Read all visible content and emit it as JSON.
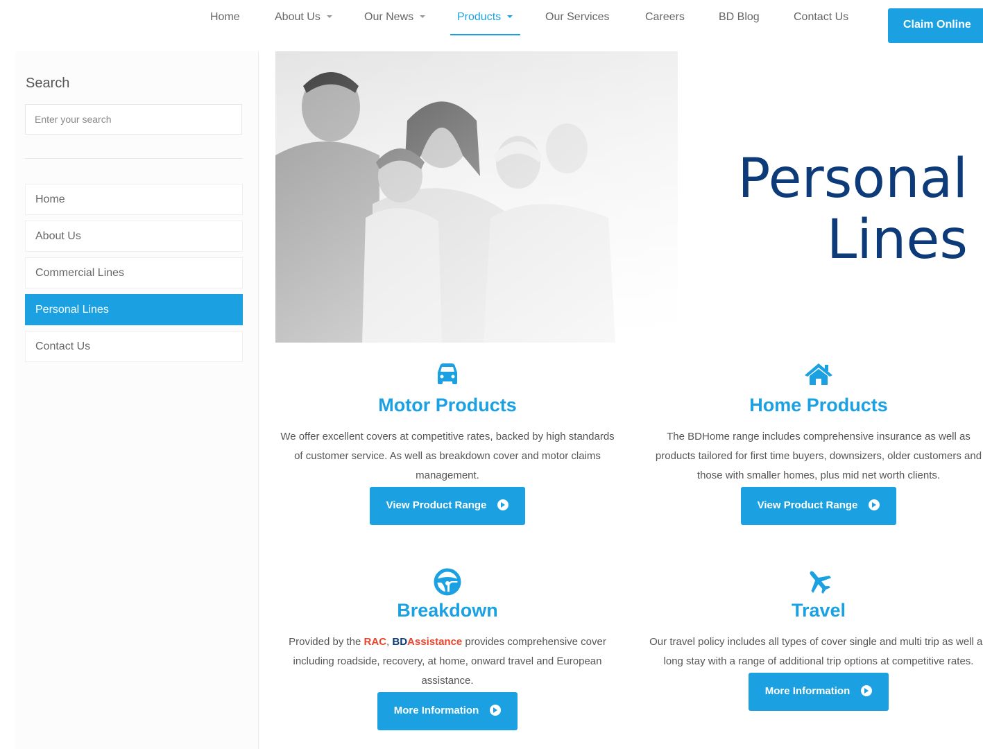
{
  "nav": {
    "items": [
      {
        "label": "Home"
      },
      {
        "label": "About Us"
      },
      {
        "label": "Our News"
      },
      {
        "label": "Products"
      },
      {
        "label": "Our Services"
      },
      {
        "label": "Careers"
      },
      {
        "label": "BD Blog"
      },
      {
        "label": "Contact Us"
      }
    ],
    "active": "Products",
    "claim_button": "Claim Online"
  },
  "sidebar": {
    "search_title": "Search",
    "search_placeholder": "Enter your search",
    "menu": [
      {
        "label": "Home"
      },
      {
        "label": "About Us"
      },
      {
        "label": "Commercial Lines"
      },
      {
        "label": "Personal Lines"
      },
      {
        "label": "Contact Us"
      }
    ],
    "active": "Personal Lines"
  },
  "hero": {
    "title_line1": "Personal",
    "title_line2": "Lines"
  },
  "products": [
    {
      "icon": "car-icon",
      "title": "Motor Products",
      "description": "We offer excellent covers at competitive rates, backed by high standards of customer service. As well as breakdown cover and motor claims management.",
      "button": "View Product Range"
    },
    {
      "icon": "home-icon",
      "title": "Home Products",
      "description": "The BDHome range includes comprehensive insurance as well as products tailored for first time buyers, downsizers, older customers and those with smaller homes, plus mid net worth clients.",
      "button": "View Product Range"
    },
    {
      "icon": "steering-wheel-icon",
      "title": "Breakdown",
      "desc_prefix": "Provided by the ",
      "desc_rac": "RAC",
      "desc_comma": ", ",
      "desc_bd": "BD",
      "desc_assistance": "Assistance",
      "desc_suffix": " provides comprehensive cover including roadside, recovery, at home, onward travel and European assistance.",
      "button": "More Information"
    },
    {
      "icon": "plane-icon",
      "title": "Travel",
      "description": "Our travel policy includes all types of cover single and multi trip as well as long stay with a range of additional trip options at competitive rates.",
      "button": "More Information"
    }
  ],
  "colors": {
    "accent": "#1ba1e2",
    "navy": "#0d3a78",
    "rac_red": "#e8452c"
  }
}
